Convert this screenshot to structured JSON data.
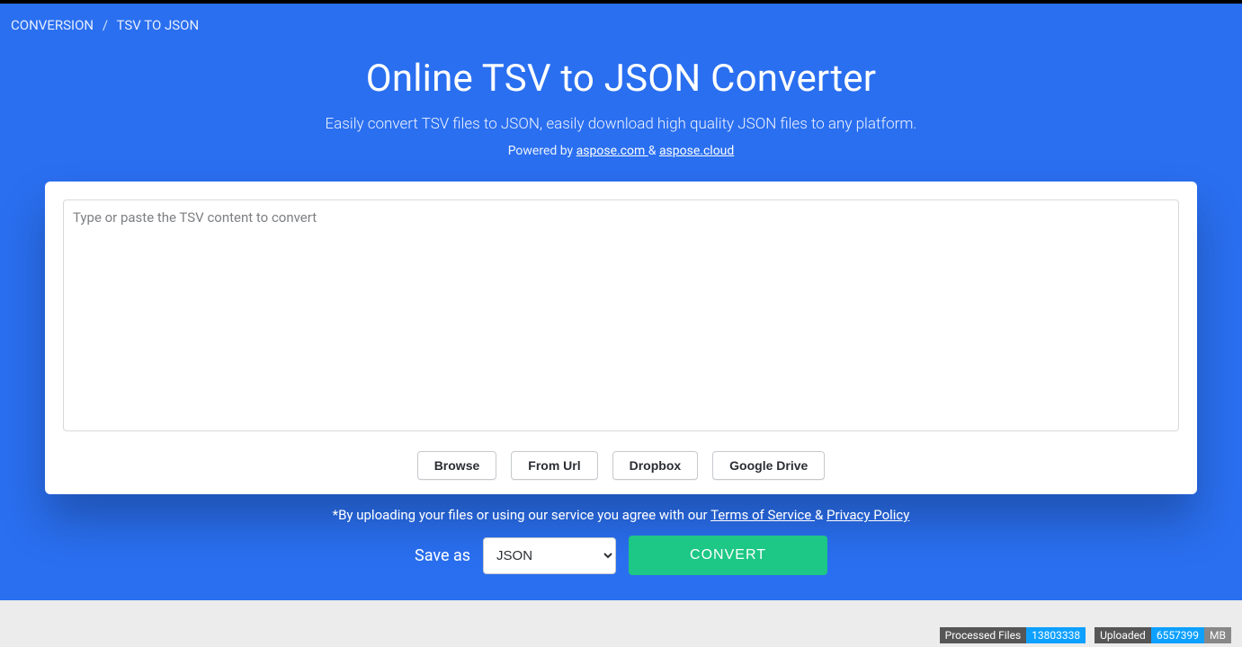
{
  "breadcrumb": {
    "root": "CONVERSION",
    "current": "TSV TO JSON"
  },
  "hero": {
    "title": "Online TSV to JSON Converter",
    "subtitle": "Easily convert TSV files to JSON, easily download high quality JSON files to any platform.",
    "powered_prefix": "Powered by ",
    "powered_link1": "aspose.com ",
    "powered_amp": "& ",
    "powered_link2": "aspose.cloud"
  },
  "textarea": {
    "placeholder": "Type or paste the TSV content to convert"
  },
  "buttons": {
    "browse": "Browse",
    "from_url": "From Url",
    "dropbox": "Dropbox",
    "google_drive": "Google Drive"
  },
  "policy": {
    "prefix": "*By uploading your files or using our service you agree with our ",
    "tos": "Terms of Service ",
    "amp": "& ",
    "privacy": "Privacy Policy"
  },
  "saveas": {
    "label": "Save as",
    "selected": "JSON"
  },
  "convert": {
    "label": "CONVERT"
  },
  "footer": {
    "processed_label": "Processed Files",
    "processed_value": "13803338",
    "uploaded_label": "Uploaded",
    "uploaded_value": "6557399",
    "uploaded_unit": "MB"
  }
}
